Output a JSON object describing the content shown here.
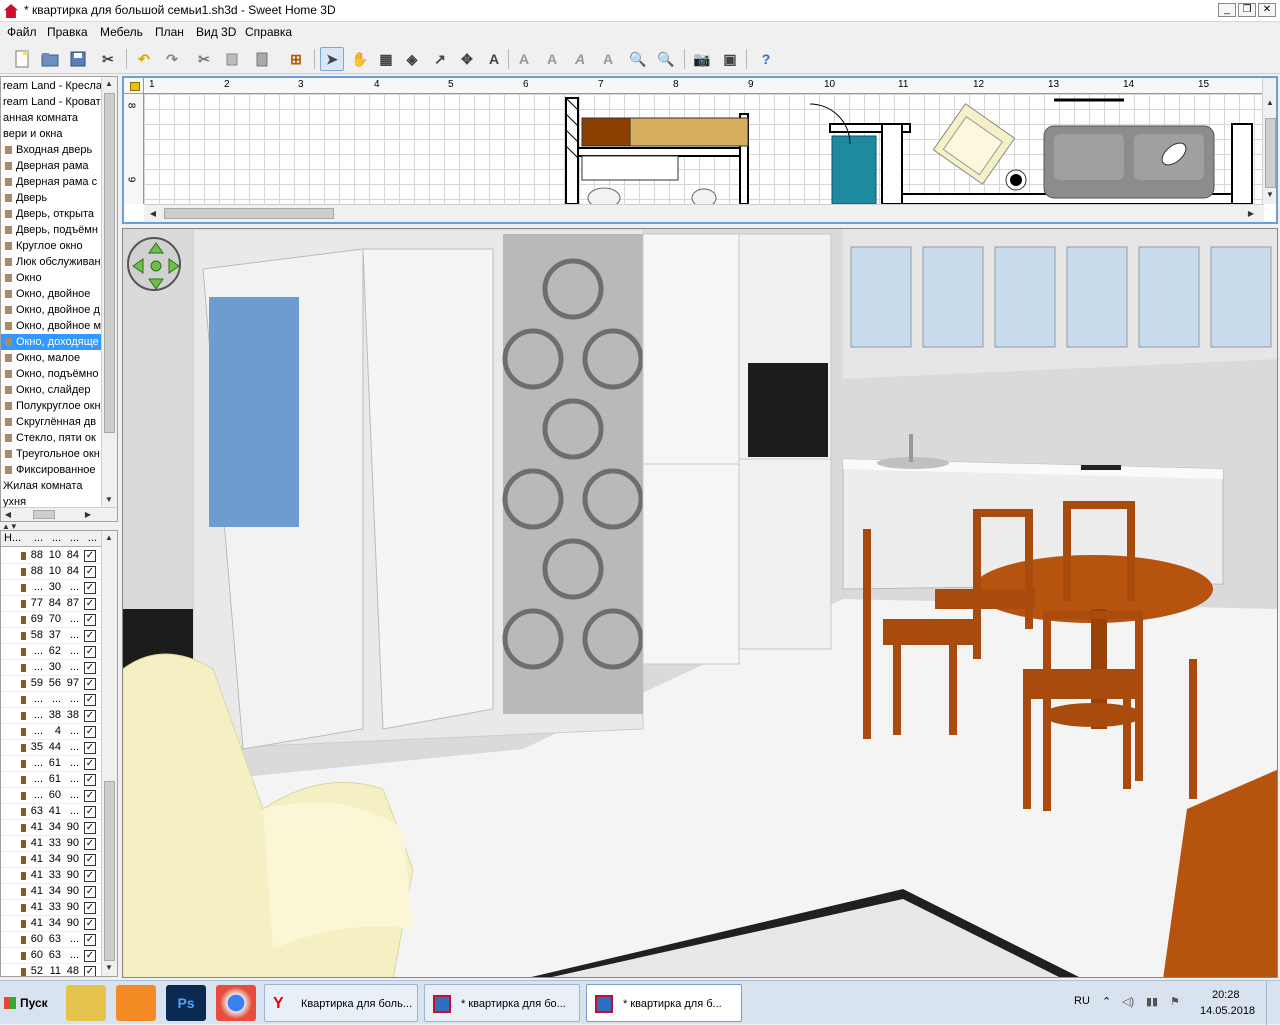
{
  "window": {
    "title": "* квартирка для большой семьи1.sh3d - Sweet Home 3D"
  },
  "menu": [
    "Файл",
    "Правка",
    "Мебель",
    "План",
    "Вид 3D",
    "Справка"
  ],
  "toolbar_icons": [
    "new-file-icon",
    "open-file-icon",
    "save-file-icon",
    "preferences-icon",
    "undo-icon",
    "redo-icon",
    "cut-icon",
    "copy-icon",
    "paste-icon",
    "add-furniture-icon",
    "select-arrow-icon",
    "pan-hand-icon",
    "create-walls-icon",
    "create-rooms-icon",
    "create-polylines-icon",
    "create-dimensions-icon",
    "add-text-icon",
    "text-style-icon",
    "text-bold-icon",
    "text-italic-icon",
    "text-increase-icon",
    "zoom-in-icon",
    "zoom-out-icon",
    "create-photo-icon",
    "create-video-icon",
    "help-icon"
  ],
  "catalog": {
    "items": [
      "ream Land - Кресла",
      "ream Land - Кроват",
      "анная комната",
      "вери и окна",
      "Входная дверь",
      "Дверная рама",
      "Дверная рама с",
      "Дверь",
      "Дверь, открыта",
      "Дверь, подъёмн",
      "Круглое окно",
      "Люк обслуживан",
      "Окно",
      "Окно, двойное",
      "Окно, двойное д",
      "Окно, двойное м",
      "Окно, доходяще",
      "Окно, малое",
      "Окно, подъёмно",
      "Окно, слайдер",
      "Полукруглое окн",
      "Скруглённая дв",
      "Стекло, пяти ок",
      "Треугольное окн",
      "Фиксированное",
      "Жилая комната",
      "ухня"
    ],
    "selected_index": 16
  },
  "furniture_table": {
    "headers": [
      "Н...",
      "...",
      "...",
      "...",
      "..."
    ],
    "rows": [
      [
        "88",
        "10",
        "84",
        true
      ],
      [
        "88",
        "10",
        "84",
        true
      ],
      [
        "...",
        "30",
        "...",
        true
      ],
      [
        "77",
        "84",
        "87",
        true
      ],
      [
        "69",
        "70",
        "...",
        true
      ],
      [
        "58",
        "37",
        "...",
        true
      ],
      [
        "...",
        "62",
        "...",
        true
      ],
      [
        "...",
        "30",
        "...",
        true
      ],
      [
        "59",
        "56",
        "97",
        true
      ],
      [
        "...",
        "...",
        "...",
        true
      ],
      [
        "...",
        "38",
        "38",
        true
      ],
      [
        "...",
        "4",
        "...",
        true
      ],
      [
        "35",
        "44",
        "...",
        true
      ],
      [
        "...",
        "61",
        "...",
        true
      ],
      [
        "...",
        "61",
        "...",
        true
      ],
      [
        "...",
        "60",
        "...",
        true
      ],
      [
        "63",
        "41",
        "...",
        true
      ],
      [
        "41",
        "34",
        "90",
        true
      ],
      [
        "41",
        "33",
        "90",
        true
      ],
      [
        "41",
        "34",
        "90",
        true
      ],
      [
        "41",
        "33",
        "90",
        true
      ],
      [
        "41",
        "34",
        "90",
        true
      ],
      [
        "41",
        "33",
        "90",
        true
      ],
      [
        "41",
        "34",
        "90",
        true
      ],
      [
        "60",
        "63",
        "...",
        true
      ],
      [
        "60",
        "63",
        "...",
        true
      ],
      [
        "52",
        "11",
        "48",
        true
      ]
    ]
  },
  "plan": {
    "ruler_x": [
      "1",
      "2",
      "3",
      "4",
      "5",
      "6",
      "7",
      "8",
      "9",
      "10",
      "11",
      "12",
      "13",
      "14",
      "15"
    ],
    "ruler_y": [
      "8",
      "9"
    ]
  },
  "taskbar": {
    "start_label": "Пуск",
    "tasks": [
      "Квартирка для боль...",
      "* квартирка для бо...",
      "* квартирка для б..."
    ],
    "lang": "RU",
    "time": "20:28",
    "date": "14.05.2018"
  },
  "colors": {
    "selection": "#3399ff",
    "plan_border": "#6d9dd7",
    "chairs": "#b5530f",
    "armchair": "#f5f0c8",
    "cabinet_teal": "#1d8aa0"
  }
}
